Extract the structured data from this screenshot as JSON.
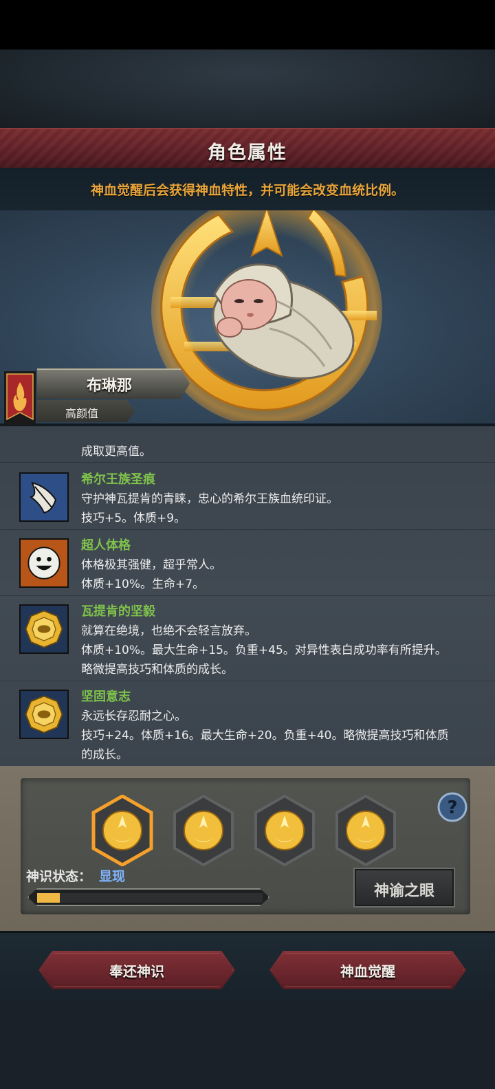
{
  "header": {
    "title": "角色属性"
  },
  "notice": "神血觉醒后会获得神血特性，并可能会改变血统比例。",
  "character": {
    "name": "布琳那",
    "tag": "高颜值"
  },
  "traits": {
    "partial_line": "成取更高值。",
    "items": [
      {
        "name": "希尔王族圣痕",
        "desc": "守护神瓦提肯的青睐，忠心的希尔王族血统印证。",
        "effect": "技巧+5。体质+9。",
        "icon": "feather-mark-icon"
      },
      {
        "name": "超人体格",
        "desc": "体格极其强健，超乎常人。",
        "effect": "体质+10%。生命+7。",
        "icon": "smiley-face-icon"
      },
      {
        "name": "瓦提肯的坚毅",
        "desc": "就算在绝境，也绝不会轻言放弃。",
        "effect": "体质+10%。最大生命+15。负重+45。对异性表白成功率有所提升。",
        "effect2": "略微提高技巧和体质的成长。",
        "icon": "golden-medal-icon"
      },
      {
        "name": "坚固意志",
        "desc": "永远长存忍耐之心。",
        "effect": "技巧+24。体质+16。最大生命+20。负重+40。略微提高技巧和体质",
        "effect2": "的成长。",
        "icon": "golden-medal-icon"
      }
    ]
  },
  "divine": {
    "status_label": "神识状态：",
    "status_value": "显现",
    "progress": 0.1,
    "slots": 4,
    "selected_slot": 0,
    "oracle_button": "神谕之眼",
    "help_icon": "question-mark-icon"
  },
  "footer": {
    "return_button": "奉还神识",
    "awaken_button": "神血觉醒"
  },
  "colors": {
    "accent_gold": "#f0b844",
    "trait_name": "#7fc24b",
    "banner_red": "#6a252c",
    "status_blue": "#7fb6ff"
  }
}
